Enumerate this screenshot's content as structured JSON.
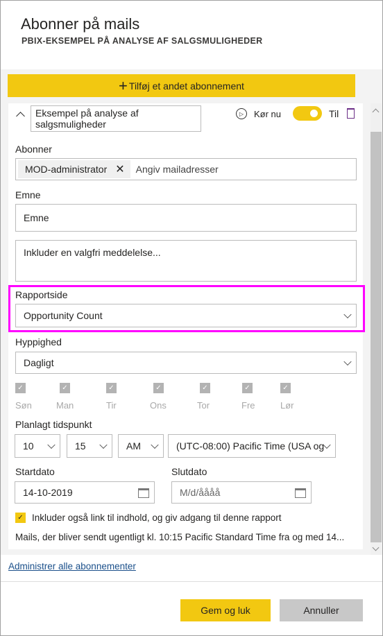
{
  "header": {
    "title": "Abonner på mails",
    "subtitle": "PBIX-EKSEMPEL PÅ ANALYSE AF SALGSMULIGHEDER"
  },
  "add_button": "Tilføj et andet abonnement",
  "subscription": {
    "name": "Eksempel på analyse af salgsmuligheder",
    "run_now": "Kør nu",
    "toggle_label": "Til",
    "toggle_on": true,
    "subscribers_label": "Abonner",
    "subscriber_chip": "MOD-administrator",
    "email_placeholder": "Angiv mailadresser",
    "subject_label": "Emne",
    "subject_value": "Emne",
    "message_placeholder": "Inkluder en valgfri meddelelse...",
    "report_page_label": "Rapportside",
    "report_page_value": "Opportunity Count",
    "frequency_label": "Hyppighed",
    "frequency_value": "Dagligt",
    "days": [
      "Søn",
      "Man",
      "Tir",
      "Ons",
      "Tor",
      "Fre",
      "Lør"
    ],
    "time_label": "Planlagt tidspunkt",
    "hour": "10",
    "minute": "15",
    "ampm": "AM",
    "timezone": "(UTC-08:00) Pacific Time (USA og",
    "start_label": "Startdato",
    "start_value": "14-10-2019",
    "end_label": "Slutdato",
    "end_placeholder": "M/d/åååå",
    "include_link_label": "Inkluder også link til indhold, og giv adgang til denne rapport",
    "include_link_checked": true,
    "summary": "Mails, der bliver sendt ugentligt kl. 10:15 Pacific Standard Time fra og med 14..."
  },
  "manage_link": "Administrer alle abonnementer",
  "footer": {
    "save": "Gem og luk",
    "cancel": "Annuller"
  },
  "colors": {
    "accent": "#f2c811",
    "highlight": "#ff00ff"
  }
}
